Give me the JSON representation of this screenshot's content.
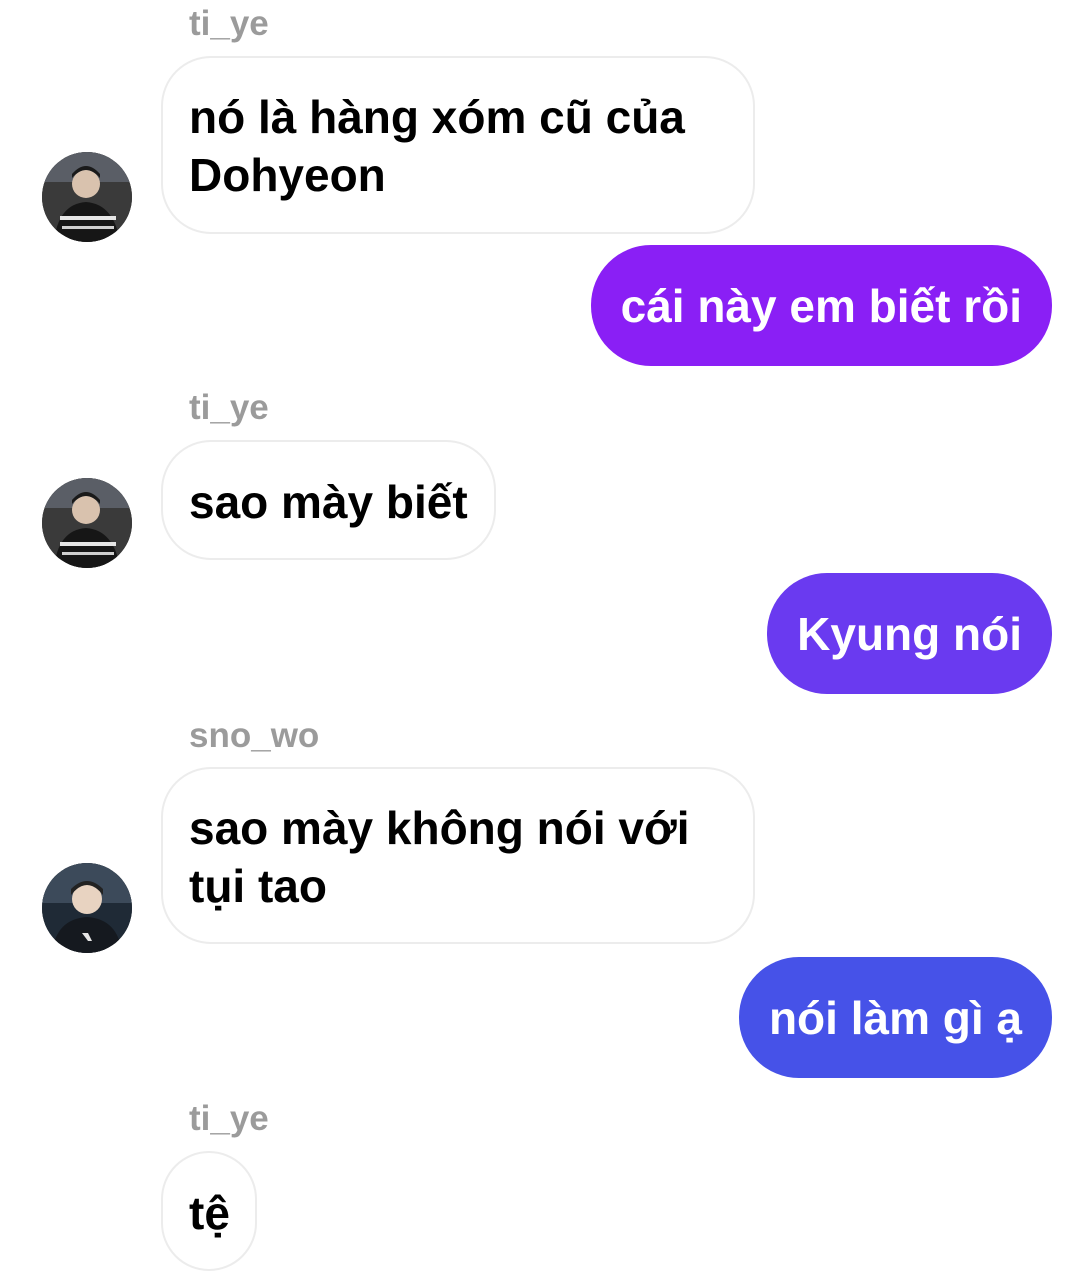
{
  "colors": {
    "outgoing_1": "#8a1ff5",
    "outgoing_2": "#6a3af0",
    "outgoing_3": "#4652e8",
    "sender_name": "#9b9b9b",
    "incoming_border": "#ececec"
  },
  "messages": [
    {
      "direction": "incoming",
      "sender": "ti_ye",
      "avatar": "avatar-tiye-photo",
      "lines": [
        "nó là hàng xóm cũ của",
        "Dohyeon"
      ]
    },
    {
      "direction": "outgoing",
      "text": "cái này em biết rồi"
    },
    {
      "direction": "incoming",
      "sender": "ti_ye",
      "avatar": "avatar-tiye-photo",
      "lines": [
        "sao mày biết"
      ]
    },
    {
      "direction": "outgoing",
      "text": "Kyung nói"
    },
    {
      "direction": "incoming",
      "sender": "sno_wo",
      "avatar": "avatar-snowo-photo",
      "lines": [
        "sao mày không nói với",
        "tụi tao"
      ]
    },
    {
      "direction": "outgoing",
      "text": "nói làm gì ạ"
    },
    {
      "direction": "incoming",
      "sender": "ti_ye",
      "lines": [
        "tệ"
      ]
    }
  ]
}
